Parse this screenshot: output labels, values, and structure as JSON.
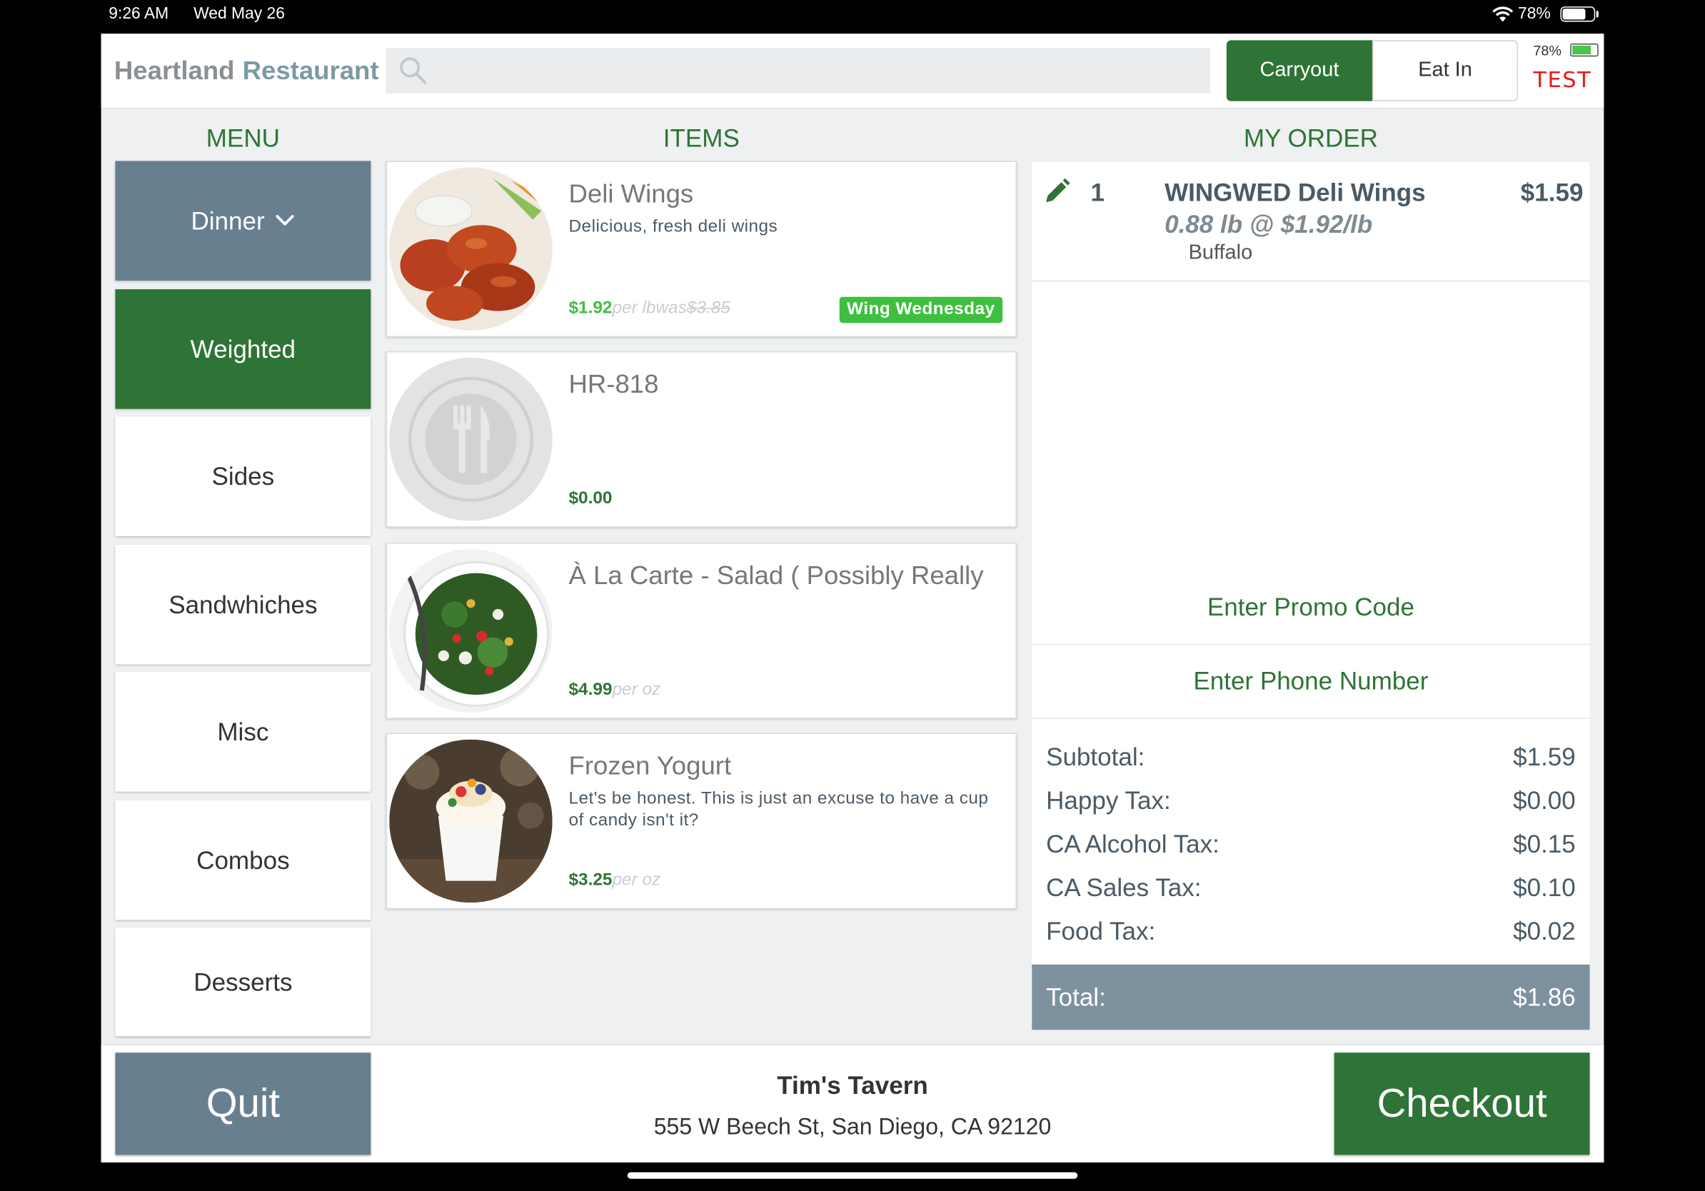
{
  "status_bar": {
    "time": "9:26 AM",
    "date": "Wed May 26",
    "battery": "78%",
    "battery_level": 0.78
  },
  "header": {
    "logo_part1": "Heartland",
    "logo_part2": "Restaurant",
    "search_placeholder": "",
    "order_types": [
      {
        "label": "Carryout",
        "selected": true
      },
      {
        "label": "Eat In",
        "selected": false
      }
    ],
    "battery": "78%",
    "env_label": "TEST"
  },
  "columns": {
    "menu": "MENU",
    "items": "ITEMS",
    "order": "MY ORDER"
  },
  "menu": {
    "dropdown_label": "Dinner",
    "categories": [
      {
        "label": "Weighted",
        "active": true
      },
      {
        "label": "Sides",
        "active": false
      },
      {
        "label": "Sandwhiches",
        "active": false
      },
      {
        "label": "Misc",
        "active": false
      },
      {
        "label": "Combos",
        "active": false
      },
      {
        "label": "Desserts",
        "active": false
      }
    ]
  },
  "items": [
    {
      "name": "Deli Wings",
      "description": "Delicious, fresh deli wings",
      "price": "$1.92",
      "unit": "per lb",
      "was_label": "was",
      "was_price": "$3.85",
      "badge": "Wing Wednesday",
      "image": "chicken-wings-photo"
    },
    {
      "name": "HR-818",
      "description": "",
      "price": "$0.00",
      "unit": "",
      "image": "plate-utensils-placeholder-icon"
    },
    {
      "name": "À La Carte - Salad ( Possibly Really",
      "description": "",
      "price": "$4.99",
      "unit": "per oz",
      "image": "salad-bowl-photo"
    },
    {
      "name": "Frozen Yogurt",
      "description": "Let's be honest. This is just an excuse to have a cup of candy isn't it?",
      "price": "$3.25",
      "unit": "per oz",
      "image": "frozen-yogurt-photo"
    }
  ],
  "order": {
    "line_items": [
      {
        "qty": "1",
        "name": "WINGWED Deli Wings",
        "price": "$1.59",
        "weight": "0.88 lb @ $1.92/lb",
        "modifier": "Buffalo"
      }
    ],
    "promo_label": "Enter Promo Code",
    "phone_label": "Enter Phone Number",
    "totals": [
      {
        "label": "Subtotal:",
        "value": "$1.59"
      },
      {
        "label": "Happy Tax:",
        "value": "$0.00"
      },
      {
        "label": "CA Alcohol Tax:",
        "value": "$0.15"
      },
      {
        "label": "CA Sales Tax:",
        "value": "$0.10"
      },
      {
        "label": "Food Tax:",
        "value": "$0.02"
      }
    ],
    "total_label": "Total:",
    "total_value": "$1.86"
  },
  "footer": {
    "quit_label": "Quit",
    "store_name": "Tim's Tavern",
    "store_address": "555 W Beech St, San Diego, CA 92120",
    "checkout_label": "Checkout"
  },
  "colors": {
    "brand_green": "#2e7436",
    "slate": "#687f90",
    "badge_green": "#3fbf3f",
    "test_red": "#e11b1b"
  }
}
